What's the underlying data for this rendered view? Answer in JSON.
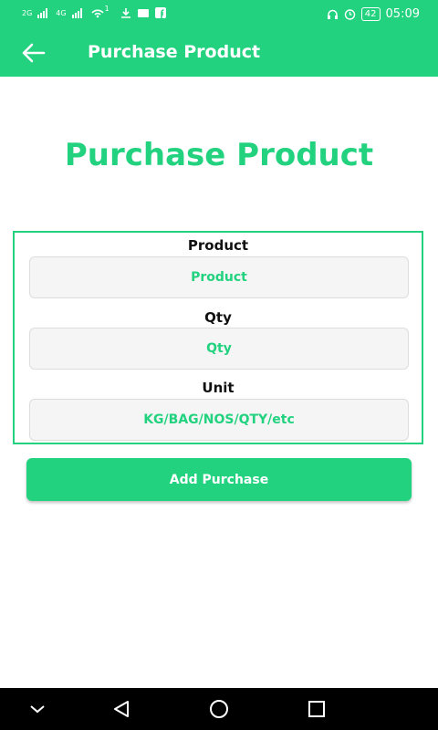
{
  "status_bar": {
    "left_indicators": [
      "2G",
      "4G",
      "1"
    ],
    "battery": "42",
    "time": "05:09"
  },
  "app_bar": {
    "title": "Purchase Product",
    "back_icon": "arrow-left-icon"
  },
  "page": {
    "title": "Purchase Product"
  },
  "form": {
    "product": {
      "label": "Product",
      "placeholder": "Product"
    },
    "qty": {
      "label": "Qty",
      "placeholder": "Qty"
    },
    "unit": {
      "label": "Unit",
      "placeholder": "KG/BAG/NOS/QTY/etc"
    },
    "submit_label": "Add Purchase"
  },
  "nav_bar": {
    "icons": [
      "chevron-down-icon",
      "back-triangle-icon",
      "home-circle-icon",
      "recents-square-icon"
    ]
  },
  "colors": {
    "accent": "#22d27f",
    "background": "#ffffff",
    "nav_bar": "#000000"
  }
}
